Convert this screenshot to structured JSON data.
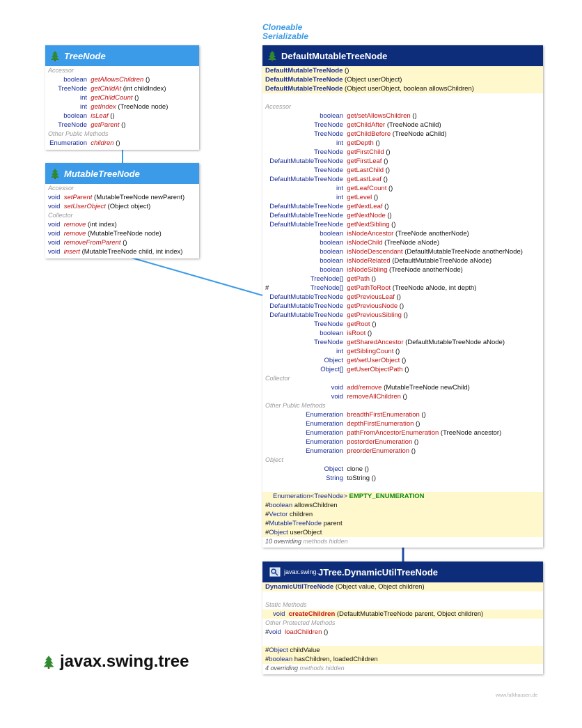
{
  "interfaces_label": [
    "Cloneable",
    "Serializable"
  ],
  "package_title": "javax.swing.tree",
  "watermark": "www.falkhausen.de",
  "tree_node": {
    "title": "TreeNode",
    "sections": [
      {
        "name": "Accessor",
        "rows": [
          {
            "type": "boolean",
            "name": "getAllowsChildren",
            "params": " ()"
          },
          {
            "type": "TreeNode",
            "name": "getChildAt",
            "params": " (int childIndex)"
          },
          {
            "type": "int",
            "name": "getChildCount",
            "params": " ()"
          },
          {
            "type": "int",
            "name": "getIndex",
            "params": " (TreeNode node)"
          },
          {
            "type": "boolean",
            "name": "isLeaf",
            "params": " ()"
          },
          {
            "type": "TreeNode",
            "name": "getParent",
            "params": " ()"
          }
        ]
      },
      {
        "name": "Other Public Methods",
        "rows": [
          {
            "type": "Enumeration",
            "name": "children",
            "params": " ()"
          }
        ]
      }
    ]
  },
  "mutable_tree_node": {
    "title": "MutableTreeNode",
    "sections": [
      {
        "name": "Accessor",
        "rows": [
          {
            "type": "void",
            "name": "setParent",
            "params": " (MutableTreeNode newParent)"
          },
          {
            "type": "void",
            "name": "setUserObject",
            "params": " (Object object)"
          }
        ]
      },
      {
        "name": "Collector",
        "rows": [
          {
            "type": "void",
            "name": "remove",
            "params": " (int index)"
          },
          {
            "type": "void",
            "name": "remove",
            "params": " (MutableTreeNode node)"
          },
          {
            "type": "void",
            "name": "removeFromParent",
            "params": " ()"
          },
          {
            "type": "void",
            "name": "insert",
            "params": " (MutableTreeNode child, int index)"
          }
        ]
      }
    ]
  },
  "default_mutable_tree_node": {
    "title": "DefaultMutableTreeNode",
    "constructors": [
      {
        "name": "DefaultMutableTreeNode",
        "params": " ()"
      },
      {
        "name": "DefaultMutableTreeNode",
        "params": " (Object userObject)"
      },
      {
        "name": "DefaultMutableTreeNode",
        "params": " (Object userObject, boolean allowsChildren)"
      }
    ],
    "sections": [
      {
        "name": "Accessor",
        "rows": [
          {
            "type": "boolean",
            "name": "get/setAllowsChildren",
            "params": " ()",
            "plain": true
          },
          {
            "type": "TreeNode",
            "name": "getChildAfter",
            "params": " (TreeNode aChild)"
          },
          {
            "type": "TreeNode",
            "name": "getChildBefore",
            "params": " (TreeNode aChild)"
          },
          {
            "type": "int",
            "name": "getDepth",
            "params": " ()"
          },
          {
            "type": "TreeNode",
            "name": "getFirstChild",
            "params": " ()"
          },
          {
            "type": "DefaultMutableTreeNode",
            "name": "getFirstLeaf",
            "params": " ()"
          },
          {
            "type": "TreeNode",
            "name": "getLastChild",
            "params": " ()"
          },
          {
            "type": "DefaultMutableTreeNode",
            "name": "getLastLeaf",
            "params": " ()"
          },
          {
            "type": "int",
            "name": "getLeafCount",
            "params": " ()"
          },
          {
            "type": "int",
            "name": "getLevel",
            "params": " ()"
          },
          {
            "type": "DefaultMutableTreeNode",
            "name": "getNextLeaf",
            "params": " ()"
          },
          {
            "type": "DefaultMutableTreeNode",
            "name": "getNextNode",
            "params": " ()"
          },
          {
            "type": "DefaultMutableTreeNode",
            "name": "getNextSibling",
            "params": " ()"
          },
          {
            "type": "boolean",
            "name": "isNodeAncestor",
            "params": " (TreeNode anotherNode)"
          },
          {
            "type": "boolean",
            "name": "isNodeChild",
            "params": " (TreeNode aNode)"
          },
          {
            "type": "boolean",
            "name": "isNodeDescendant",
            "params": " (DefaultMutableTreeNode anotherNode)"
          },
          {
            "type": "boolean",
            "name": "isNodeRelated",
            "params": " (DefaultMutableTreeNode aNode)"
          },
          {
            "type": "boolean",
            "name": "isNodeSibling",
            "params": " (TreeNode anotherNode)"
          },
          {
            "type": "TreeNode[]",
            "name": "getPath",
            "params": " ()"
          },
          {
            "type": "TreeNode[]",
            "name": "getPathToRoot",
            "params": " (TreeNode aNode, int depth)",
            "hash": "#"
          },
          {
            "type": "DefaultMutableTreeNode",
            "name": "getPreviousLeaf",
            "params": " ()"
          },
          {
            "type": "DefaultMutableTreeNode",
            "name": "getPreviousNode",
            "params": " ()"
          },
          {
            "type": "DefaultMutableTreeNode",
            "name": "getPreviousSibling",
            "params": " ()"
          },
          {
            "type": "TreeNode",
            "name": "getRoot",
            "params": " ()"
          },
          {
            "type": "boolean",
            "name": "isRoot",
            "params": " ()"
          },
          {
            "type": "TreeNode",
            "name": "getSharedAncestor",
            "params": " (DefaultMutableTreeNode aNode)"
          },
          {
            "type": "int",
            "name": "getSiblingCount",
            "params": " ()"
          },
          {
            "type": "Object",
            "name": "get/setUserObject",
            "params": " ()",
            "plain": true
          },
          {
            "type": "Object[]",
            "name": "getUserObjectPath",
            "params": " ()"
          }
        ]
      },
      {
        "name": "Collector",
        "rows": [
          {
            "type": "void",
            "name": "add/remove",
            "params": " (MutableTreeNode newChild)",
            "plain": true
          },
          {
            "type": "void",
            "name": "removeAllChildren",
            "params": " ()"
          }
        ]
      },
      {
        "name": "Other Public Methods",
        "rows": [
          {
            "type": "Enumeration",
            "name": "breadthFirstEnumeration",
            "params": " ()"
          },
          {
            "type": "Enumeration",
            "name": "depthFirstEnumeration",
            "params": " ()"
          },
          {
            "type": "Enumeration",
            "name": "pathFromAncestorEnumeration",
            "params": " (TreeNode ancestor)"
          },
          {
            "type": "Enumeration",
            "name": "postorderEnumeration",
            "params": " ()"
          },
          {
            "type": "Enumeration",
            "name": "preorderEnumeration",
            "params": " ()"
          }
        ]
      },
      {
        "name": "Object",
        "rows": [
          {
            "type": "Object",
            "name": "clone",
            "params": " ()",
            "black": true
          },
          {
            "type": "String",
            "name": "toString",
            "params": " ()",
            "black": true
          }
        ]
      }
    ],
    "static_field": {
      "type": "Enumeration",
      "generic": "<TreeNode>",
      "name": "EMPTY_ENUMERATION"
    },
    "fields": [
      {
        "hash": "#",
        "type": "boolean",
        "name": "allowsChildren"
      },
      {
        "hash": "#",
        "type": "Vector",
        "name": "children"
      },
      {
        "hash": "#",
        "type": "MutableTreeNode",
        "name": "parent"
      },
      {
        "hash": "#",
        "type": "Object",
        "name": "userObject"
      }
    ],
    "hidden": {
      "count": "10 overriding",
      "rest": " methods hidden"
    }
  },
  "dynamic_util_tree_node": {
    "package": "javax.swing.",
    "title": "JTree.DynamicUtilTreeNode",
    "constructor": {
      "name": "DynamicUtilTreeNode",
      "params": " (Object value, Object children)"
    },
    "static_section": "Static Methods",
    "static_row": {
      "type": "void",
      "name": "createChildren",
      "params": " (DefaultMutableTreeNode parent, Object children)"
    },
    "protected_section": "Other Protected Methods",
    "protected_row": {
      "hash": "#",
      "type": "void",
      "name": "loadChildren",
      "params": " ()"
    },
    "fields": [
      {
        "hash": "#",
        "type": "Object",
        "name": "childValue"
      },
      {
        "hash": "#",
        "type": "boolean",
        "name": "hasChildren, loadedChildren"
      }
    ],
    "hidden": {
      "count": "4 overriding",
      "rest": " methods hidden"
    }
  }
}
